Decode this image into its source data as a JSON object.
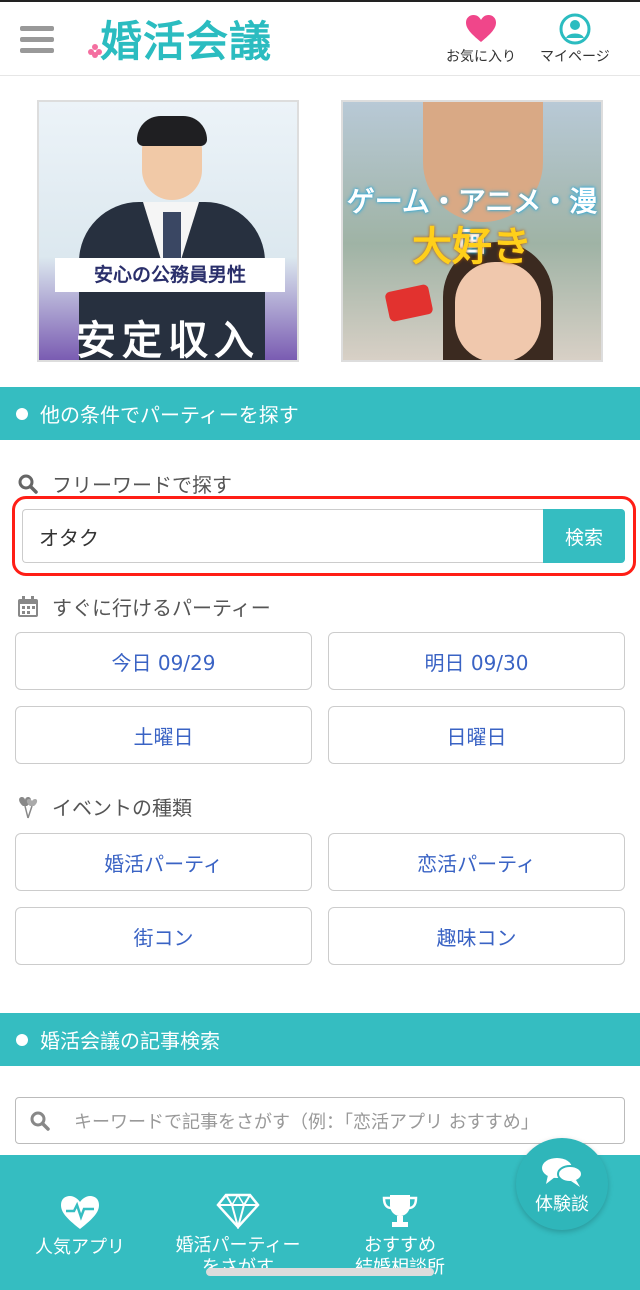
{
  "header": {
    "logo_text": "婚活会議",
    "favorites_label": "お気に入り",
    "mypage_label": "マイページ",
    "accent_color": "#2bbcc0",
    "icons": [
      "menu-icon",
      "heart-icon",
      "user-icon"
    ]
  },
  "banners": [
    {
      "label": "安心の公務員男性",
      "main": "安定収入"
    },
    {
      "line1": "ゲーム・アニメ・漫画",
      "line2": "大好き"
    }
  ],
  "party_search": {
    "section_title": "他の条件でパーティーを探す",
    "freeword_label": "フリーワードで探す",
    "freeword_value": "オタク",
    "search_button": "検索",
    "soon_label": "すぐに行けるパーティー",
    "date_buttons": [
      "今日 09/29",
      "明日 09/30",
      "土曜日",
      "日曜日"
    ],
    "event_type_label": "イベントの種類",
    "event_buttons": [
      "婚活パーティ",
      "恋活パーティ",
      "街コン",
      "趣味コン"
    ]
  },
  "article_search": {
    "section_title": "婚活会議の記事検索",
    "placeholder": "キーワードで記事をさがす（例：「恋活アプリ おすすめ」"
  },
  "bottom_nav": {
    "items": [
      "人気アプリ",
      "婚活パーティー\nをさがす",
      "おすすめ\n結婚相談所",
      "体験談"
    ],
    "color": "#35bdc1"
  }
}
